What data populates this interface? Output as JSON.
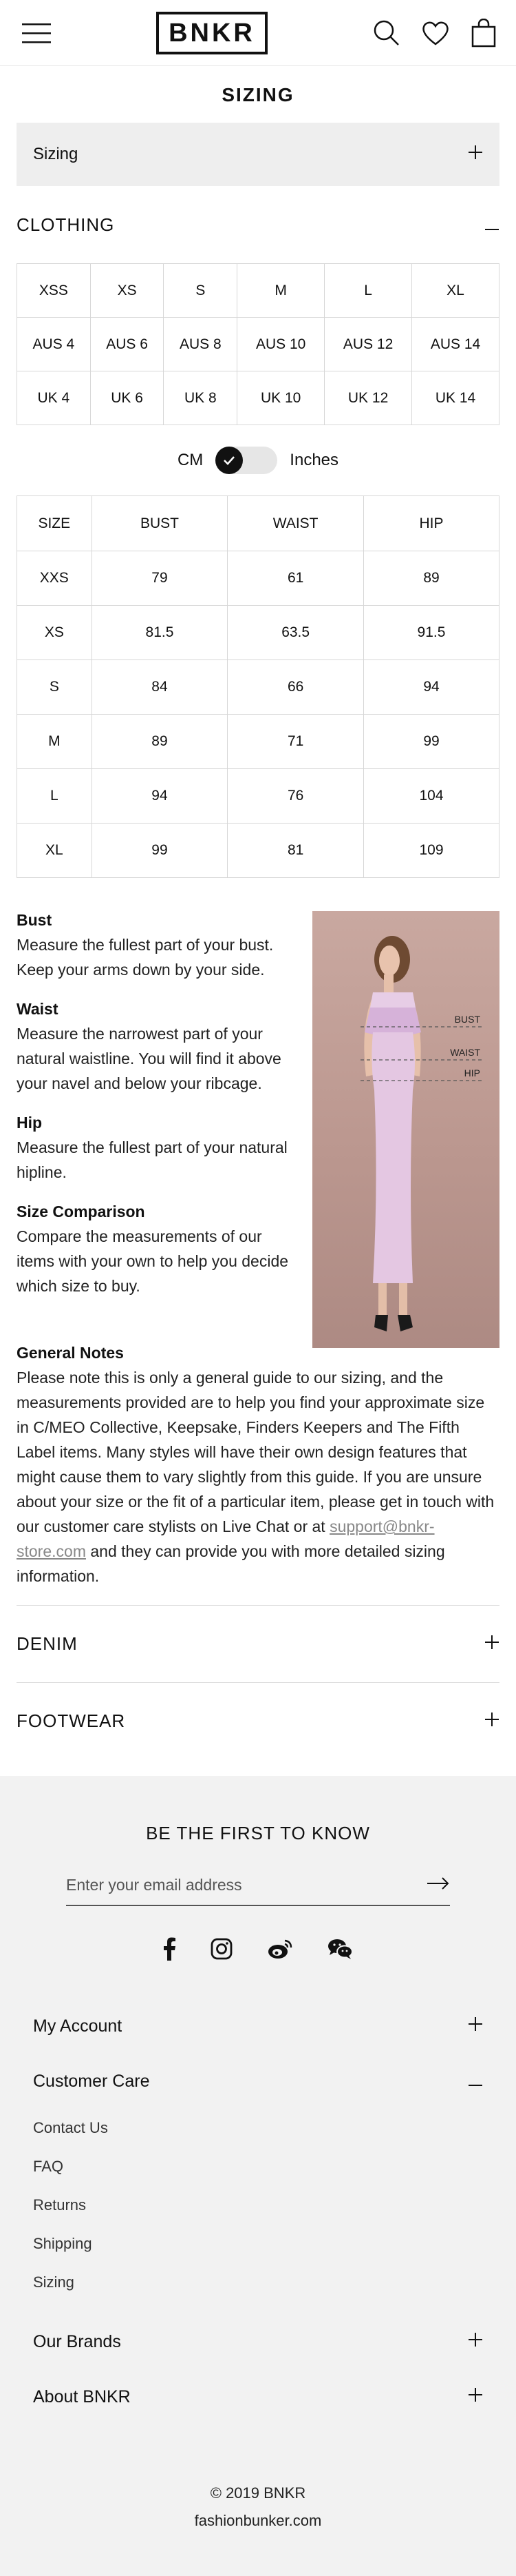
{
  "header": {
    "logo": "BNKR",
    "icons": [
      "hamburger-icon",
      "search-icon",
      "heart-icon",
      "bag-icon"
    ]
  },
  "page": {
    "title": "SIZING"
  },
  "sizing_accordion": {
    "label": "Sizing"
  },
  "clothing": {
    "heading": "CLOTHING",
    "sizes": [
      [
        "XSS",
        "XS",
        "S",
        "M",
        "L",
        "XL"
      ],
      [
        "AUS 4",
        "AUS 6",
        "AUS 8",
        "AUS 10",
        "AUS 12",
        "AUS 14"
      ],
      [
        "UK 4",
        "UK 6",
        "UK 8",
        "UK 10",
        "UK 12",
        "UK 14"
      ]
    ],
    "unit_toggle": {
      "left": "CM",
      "right": "Inches",
      "selected": "CM"
    },
    "measurements": {
      "headers": [
        "SIZE",
        "BUST",
        "WAIST",
        "HIP"
      ],
      "rows": [
        [
          "XXS",
          "79",
          "61",
          "89"
        ],
        [
          "XS",
          "81.5",
          "63.5",
          "91.5"
        ],
        [
          "S",
          "84",
          "66",
          "94"
        ],
        [
          "M",
          "89",
          "71",
          "99"
        ],
        [
          "L",
          "94",
          "76",
          "104"
        ],
        [
          "XL",
          "99",
          "81",
          "109"
        ]
      ]
    },
    "guide": [
      {
        "title": "Bust",
        "text": "Measure the fullest part of your bust. Keep your arms down by your side."
      },
      {
        "title": "Waist",
        "text": "Measure the narrowest part of your natural waistline. You will find it above your navel and below your ribcage."
      },
      {
        "title": "Hip",
        "text": "Measure the fullest part of your natural hipline."
      },
      {
        "title": "Size Comparison",
        "text": "Compare the measurements of our items with your own to help you decide which size to buy."
      }
    ],
    "image_labels": {
      "bust": "BUST",
      "waist": "WAIST",
      "hip": "HIP"
    },
    "general_notes": {
      "title": "General Notes",
      "text_before": "Please note this is only a general guide to our sizing, and the measurements provided are to help you find your approximate size in C/MEO Collective, Keepsake, Finders Keepers and The Fifth Label items. Many styles will have their own design features that might cause them to vary slightly from this guide. If you are unsure about your size or the fit of a particular item, please get in touch with our customer care stylists on Live Chat or at ",
      "email": "support@bnkr-store.com",
      "text_after": " and they can provide you with more detailed sizing information."
    }
  },
  "sections": {
    "denim": "DENIM",
    "footwear": "FOOTWEAR"
  },
  "footer": {
    "newsletter_title": "BE THE FIRST TO KNOW",
    "email_placeholder": "Enter your email address",
    "social_icons": [
      "facebook-icon",
      "instagram-icon",
      "weibo-icon",
      "wechat-icon"
    ],
    "nav": {
      "my_account": "My Account",
      "customer_care": "Customer Care",
      "customer_care_links": [
        "Contact Us",
        "FAQ",
        "Returns",
        "Shipping",
        "Sizing"
      ],
      "our_brands": "Our Brands",
      "about": "About BNKR"
    },
    "copyright": "© 2019 BNKR",
    "site": "fashionbunker.com"
  },
  "colors": {
    "text": "#111111",
    "grey_panel": "#eeeeee",
    "footer_bg": "#f2f2f2",
    "border": "#d7d7d7",
    "toggle_knob": "#111111",
    "link": "#888888"
  }
}
